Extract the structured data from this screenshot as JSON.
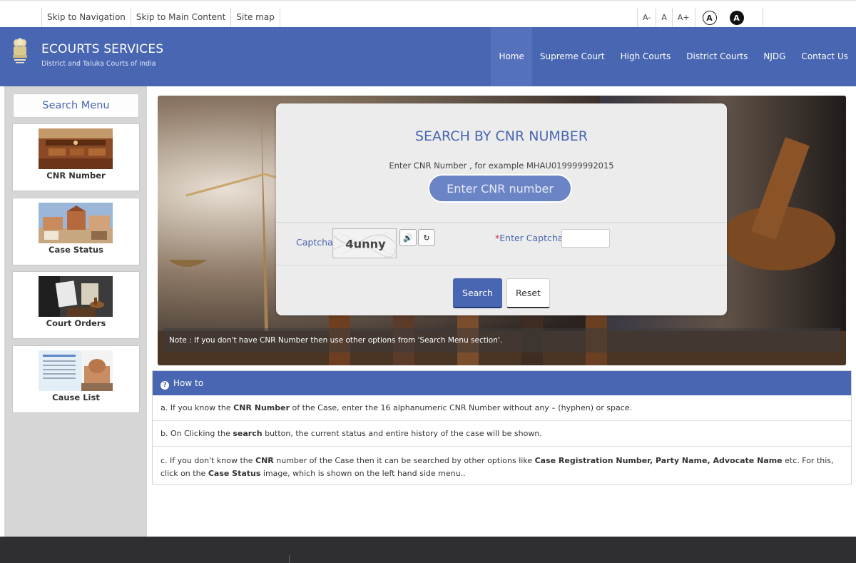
{
  "topbar": {
    "links": [
      "Skip to Navigation",
      "Skip to Main Content",
      "Site map"
    ],
    "font_sizes": [
      "A-",
      "A",
      "A+"
    ],
    "contrast_light": "A",
    "contrast_dark": "A"
  },
  "header": {
    "title": "ECOURTS SERVICES",
    "subtitle": "District and Taluka Courts of India",
    "nav": [
      "Home",
      "Supreme Court",
      "High Courts",
      "District Courts",
      "NJDG",
      "Contact Us"
    ]
  },
  "sidebar": {
    "title": "Search Menu",
    "items": [
      "CNR Number",
      "Case Status",
      "Court Orders",
      "Cause List"
    ]
  },
  "search": {
    "title": "SEARCH BY CNR NUMBER",
    "hint": "Enter CNR Number , for example MHAU019999992015",
    "placeholder": "Enter CNR number",
    "captcha_label": "Captcha",
    "captcha_text": "4unny",
    "enter_captcha_req": "*",
    "enter_captcha_label": "Enter Captcha",
    "search_label": "Search",
    "reset_label": "Reset"
  },
  "note": "Note : If you don't have CNR Number then use other options from 'Search Menu section'.",
  "howto": {
    "title": "How to",
    "row1": {
      "a": "a. If you know the ",
      "b": "CNR Number",
      "c": " of the Case, enter the 16 alphanumeric CNR Number without any – (hyphen) or space."
    },
    "row2": {
      "a": "b. On Clicking the ",
      "b": "search",
      "c": " button, the current status and entire history of the case will be shown."
    },
    "row3": {
      "a": "c. If you don't know the ",
      "b": "CNR",
      "c": " number of the Case then it can be searched by other options like ",
      "d": "Case Registration Number, Party Name, Advocate Name",
      "e": " etc. For this, click on the ",
      "f": "Case Status",
      "g": " image, which is shown on the left hand side menu.."
    }
  },
  "colors": {
    "primary": "#4866b1",
    "sidebar": "#d6d6d6",
    "footer": "#2f2f33",
    "required": "#d12c2c"
  }
}
